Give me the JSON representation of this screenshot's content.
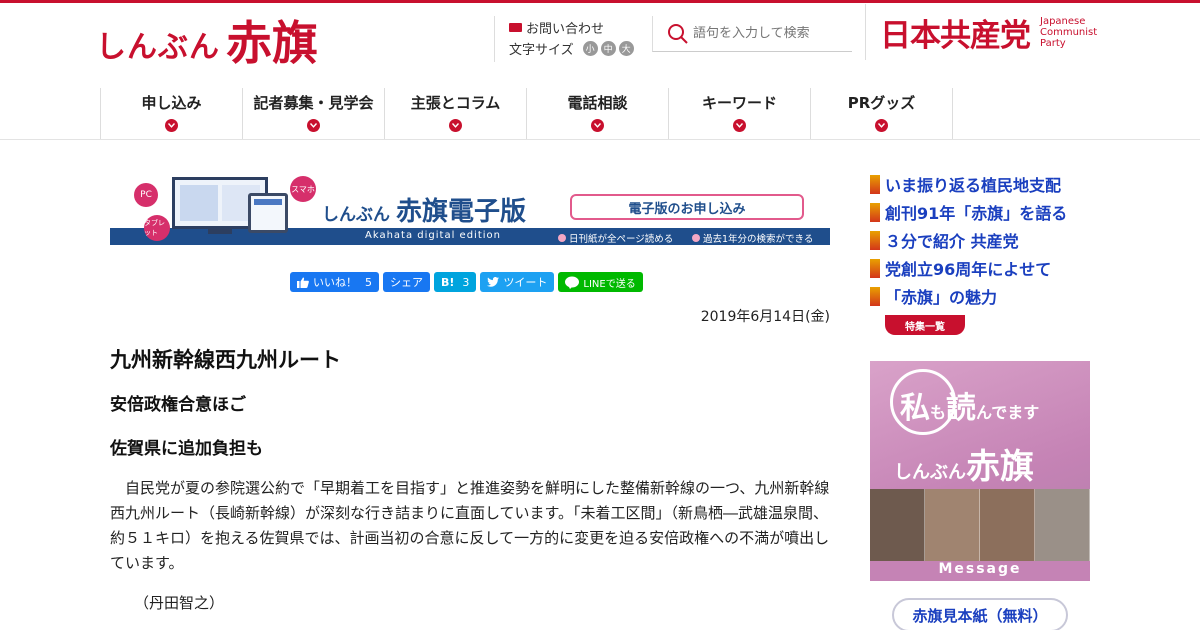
{
  "header": {
    "logo_kana": "しんぶん",
    "logo_kanji": "赤旗",
    "contact_label": "お問い合わせ",
    "font_size_label": "文字サイズ",
    "font_sizes": [
      "小",
      "中",
      "大"
    ],
    "search_placeholder": "語句を入力して検索",
    "party_name": "日本共産党",
    "party_name_en": "Japanese Communist Party"
  },
  "nav": {
    "items": [
      "申し込み",
      "記者募集・見学会",
      "主張とコラム",
      "電話相談",
      "キーワード",
      "PRグッズ"
    ]
  },
  "banner": {
    "badge_pc": "PC",
    "badge_tablet": "タブレット",
    "badge_smartphone": "スマホ",
    "title_kana": "しんぶん",
    "title_main": "赤旗電子版",
    "subtitle": "Akahata digital edition",
    "cta_label": "電子版のお申し込み",
    "feature_1": "日刊紙が全ページ読める",
    "feature_2": "過去1年分の検索ができる"
  },
  "share": {
    "like_label": "いいね！",
    "like_count": "5",
    "share_label": "シェア",
    "hatena_label": "B!",
    "hatena_count": "3",
    "tweet_label": "ツイート",
    "line_label": "LINEで送る"
  },
  "article": {
    "date": "2019年6月14日(金)",
    "title": "九州新幹線西九州ルート",
    "subtitle_1": "安倍政権合意ほご",
    "subtitle_2": "佐賀県に追加負担も",
    "body": "自民党が夏の参院選公約で「早期着工を目指す」と推進姿勢を鮮明にした整備新幹線の一つ、九州新幹線西九州ルート（長崎新幹線）が深刻な行き詰まりに直面しています。「未着工区間」（新鳥栖―武雄温泉間、約５１キロ）を抱える佐賀県では、計画当初の合意に反して一方的に変更を迫る安倍政権への不満が噴出しています。",
    "byline": "（丹田智之）"
  },
  "sidebar": {
    "links": [
      "いま振り返る植民地支配",
      "創刊91年「赤旗」を語る",
      "３分で紹介 共産党",
      "党創立96周年によせて",
      "「赤旗」の魅力"
    ],
    "more_label": "特集一覧",
    "ad_line1_a": "私",
    "ad_line1_b": "も",
    "ad_line1_c": "読",
    "ad_line1_d": "んでます",
    "ad_line2_a": "しんぶん",
    "ad_line2_b": "赤旗",
    "ad_message": "Message",
    "sample_label": "赤旗見本紙（無料）"
  },
  "colors": {
    "brand_red": "#c8102e",
    "link_blue": "#1a3fbf",
    "banner_navy": "#1f4e8c"
  }
}
